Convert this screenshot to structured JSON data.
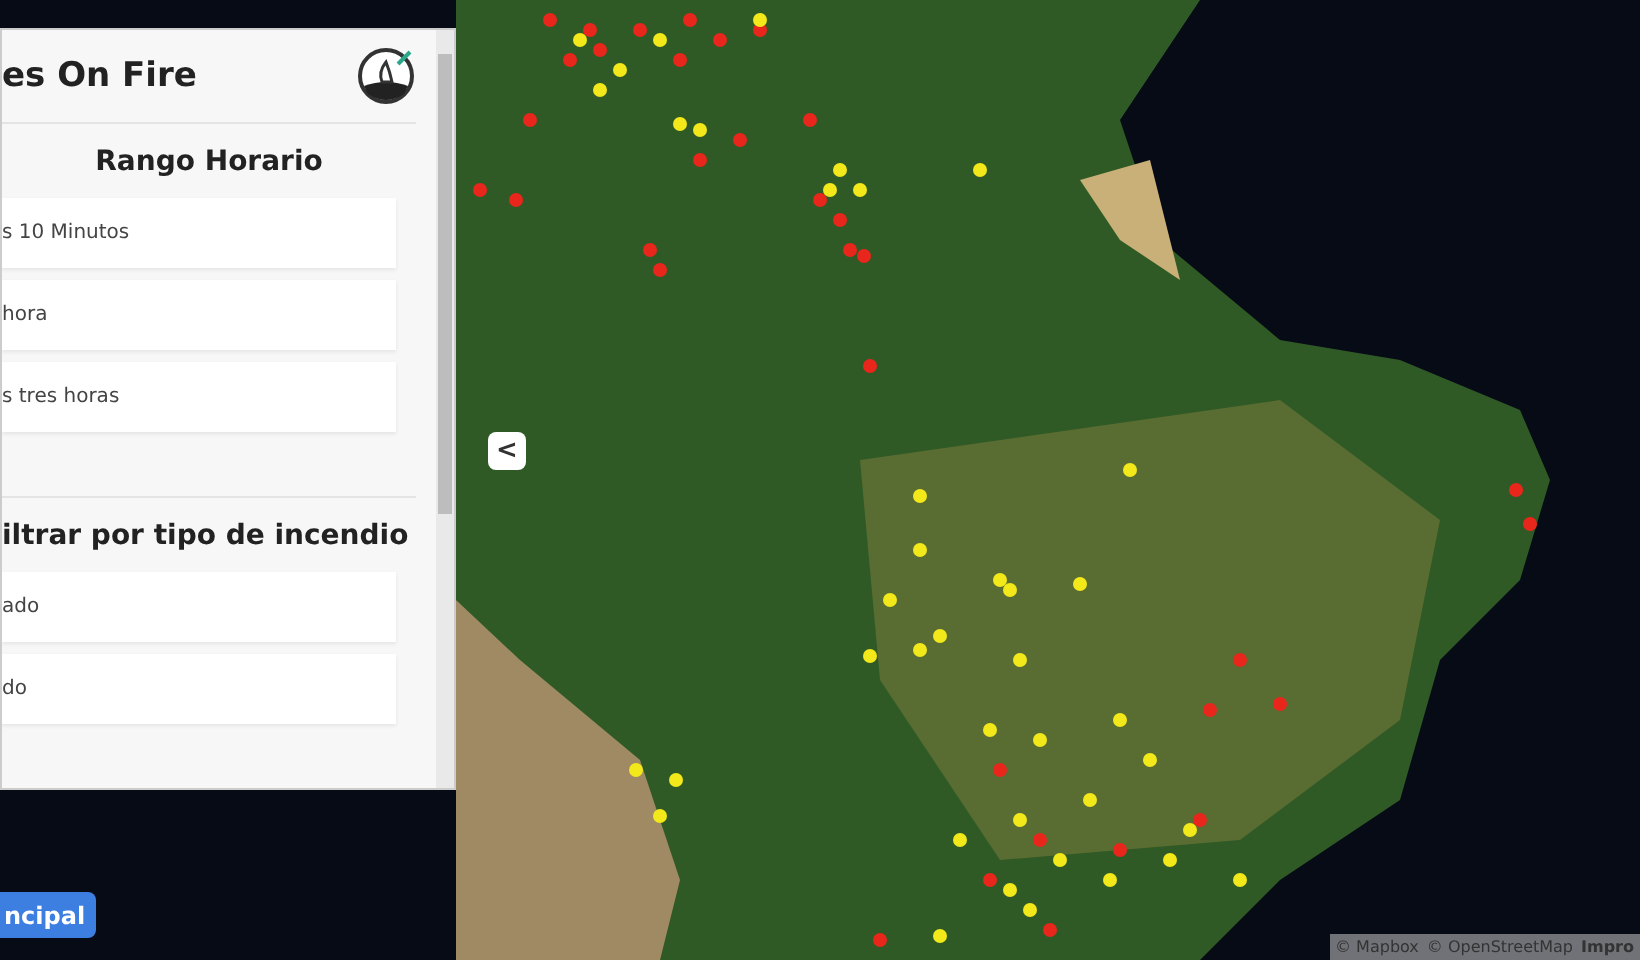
{
  "panel": {
    "title": "es On Fire",
    "sections": [
      {
        "heading": "Rango Horario",
        "options": [
          {
            "label": "s 10 Minutos"
          },
          {
            "label": "hora"
          },
          {
            "label": "s tres horas"
          }
        ]
      },
      {
        "heading": "iltrar por tipo de incendio",
        "options": [
          {
            "label": "ado"
          },
          {
            "label": "do"
          }
        ]
      }
    ]
  },
  "collapse_button": {
    "label": "<"
  },
  "main_button": {
    "label": "ncipal"
  },
  "attribution": {
    "parts": [
      {
        "text": "© Mapbox",
        "bold": false
      },
      {
        "text": "© OpenStreetMap",
        "bold": false
      },
      {
        "text": "Impro",
        "bold": true
      }
    ]
  }
}
